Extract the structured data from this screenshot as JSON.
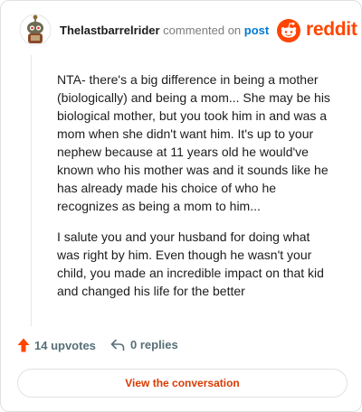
{
  "header": {
    "username": "Thelastbarrelrider",
    "action_text": "commented on",
    "post_link": "post",
    "brand": "reddit"
  },
  "comment": {
    "paragraphs": [
      "NTA- there's a big difference in being a mother (biologically) and being a mom... She may be his biological mother, but you took him in and was a mom when she didn't want him. It's up to your nephew because at 11 years old he would've known who his mother was and it sounds like he has already made his choice of who he recognizes as being a mom to him...",
      "I salute you and your husband for doing what was right by him. Even though he wasn't your child, you made an incredible impact on that kid and changed his life for the better"
    ]
  },
  "footer": {
    "upvotes": "14 upvotes",
    "replies": "0 replies",
    "cta_label": "View the conversation"
  },
  "icons": {
    "upvote": "upvote-arrow-icon",
    "reply": "reply-arrow-icon",
    "brand": "reddit-snoo-icon",
    "avatar": "user-avatar"
  },
  "colors": {
    "brand_orange": "#ff4500",
    "link_blue": "#0079d3",
    "muted_gray": "#576f76",
    "cta_text": "#d93a00"
  }
}
